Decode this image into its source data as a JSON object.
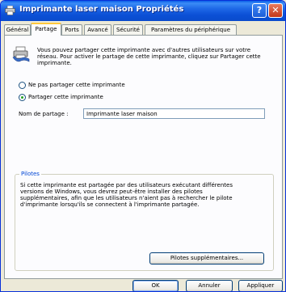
{
  "window": {
    "title": "Imprimante laser maison Propriétés",
    "help_label": "?",
    "close_label": "✕"
  },
  "tabs": [
    {
      "label": "Général"
    },
    {
      "label": "Partage"
    },
    {
      "label": "Ports"
    },
    {
      "label": "Avancé"
    },
    {
      "label": "Sécurité"
    },
    {
      "label": "Paramètres du périphérique"
    }
  ],
  "active_tab": "Partage",
  "sharing": {
    "intro": "Vous pouvez partager cette imprimante avec d'autres utilisateurs sur votre réseau. Pour activer le partage de cette imprimante, cliquez sur Partager cette imprimante.",
    "option_no_share": "Ne pas partager cette imprimante",
    "option_share": "Partager cette imprimante",
    "selected_option": "Partager cette imprimante",
    "share_name_label": "Nom de partage :",
    "share_name_value": "Imprimante laser maison"
  },
  "drivers": {
    "legend": "Pilotes",
    "text": "Si cette imprimante est partagée par des utilisateurs exécutant différentes versions de Windows, vous devrez peut-être installer des pilotes supplémentaires, afin que les utilisateurs n'aient pas à rechercher le pilote d'imprimante lorsqu'ils se connectent à l'imprimante partagée.",
    "button": "Pilotes supplémentaires..."
  },
  "footer": {
    "ok": "OK",
    "cancel": "Annuler",
    "apply": "Appliquer"
  },
  "colors": {
    "titlebar": "#0a5ee8",
    "tab_highlight": "#ffc83c",
    "legend_text": "#0046d5"
  }
}
